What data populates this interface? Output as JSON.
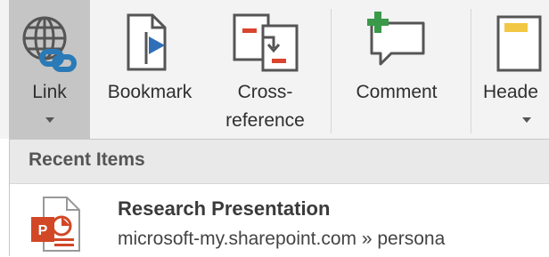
{
  "ribbon": {
    "link": {
      "label": "Link",
      "icon": "globe-link-icon"
    },
    "bookmark": {
      "label": "Bookmark",
      "icon": "bookmark-icon"
    },
    "cross_reference": {
      "label_line1": "Cross-",
      "label_line2": "reference",
      "icon": "cross-reference-icon"
    },
    "comment": {
      "label": "Comment",
      "icon": "comment-add-icon"
    },
    "header": {
      "label": "Heade",
      "icon": "header-icon"
    }
  },
  "dropdown": {
    "section_title": "Recent Items",
    "items": [
      {
        "title": "Research Presentation",
        "subtitle": "microsoft-my.sharepoint.com » persona",
        "icon": "powerpoint-file-icon"
      }
    ]
  },
  "colors": {
    "ribbon_bg": "#f3f3f3",
    "selected_bg": "#c5c5c5",
    "link_blue": "#2a7ab8",
    "bookmark_blue": "#2f6fb7",
    "cross_ref_red": "#d9452f",
    "comment_green": "#3a9a4a",
    "header_yellow": "#f2c744",
    "ppt_orange": "#d24726"
  }
}
